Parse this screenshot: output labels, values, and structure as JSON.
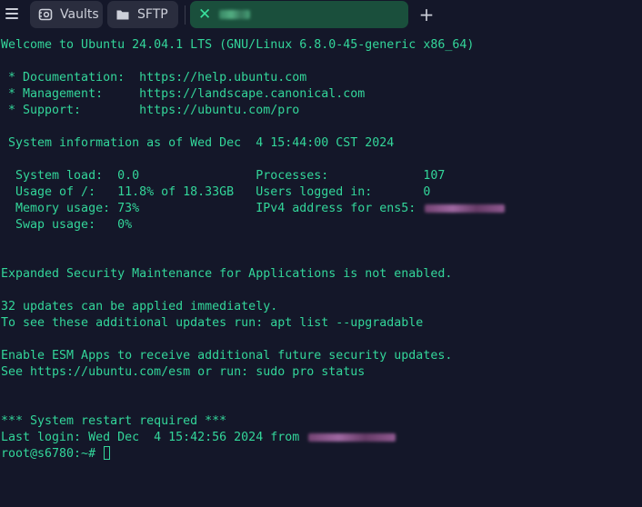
{
  "colors": {
    "background": "#141729",
    "tab_background": "#2a2d3e",
    "active_tab_background": "#1a4f3c",
    "terminal_text": "#33d69a"
  },
  "tabs": {
    "vaults_label": "Vaults",
    "sftp_label": "SFTP",
    "session_icon": "close-icon"
  },
  "terminal": {
    "welcome": "Welcome to Ubuntu 24.04.1 LTS (GNU/Linux 6.8.0-45-generic x86_64)",
    "doc": " * Documentation:  https://help.ubuntu.com",
    "mgmt": " * Management:     https://landscape.canonical.com",
    "support": " * Support:        https://ubuntu.com/pro",
    "sysinfo": " System information as of Wed Dec  4 15:44:00 CST 2024",
    "load": "  System load:  0.0                Processes:             107",
    "usage": "  Usage of /:   11.8% of 18.33GB   Users logged in:       0",
    "memory": "  Memory usage: 73%                IPv4 address for ens5: ",
    "swap": "  Swap usage:   0%",
    "esm": "Expanded Security Maintenance for Applications is not enabled.",
    "updates": "32 updates can be applied immediately.",
    "updates_hint": "To see these additional updates run: apt list --upgradable",
    "esm_apps": "Enable ESM Apps to receive additional future security updates.",
    "esm_see": "See https://ubuntu.com/esm or run: sudo pro status",
    "restart": "*** System restart required ***",
    "last_login": "Last login: Wed Dec  4 15:42:56 2024 from ",
    "prompt": "root@s6780:~# "
  }
}
